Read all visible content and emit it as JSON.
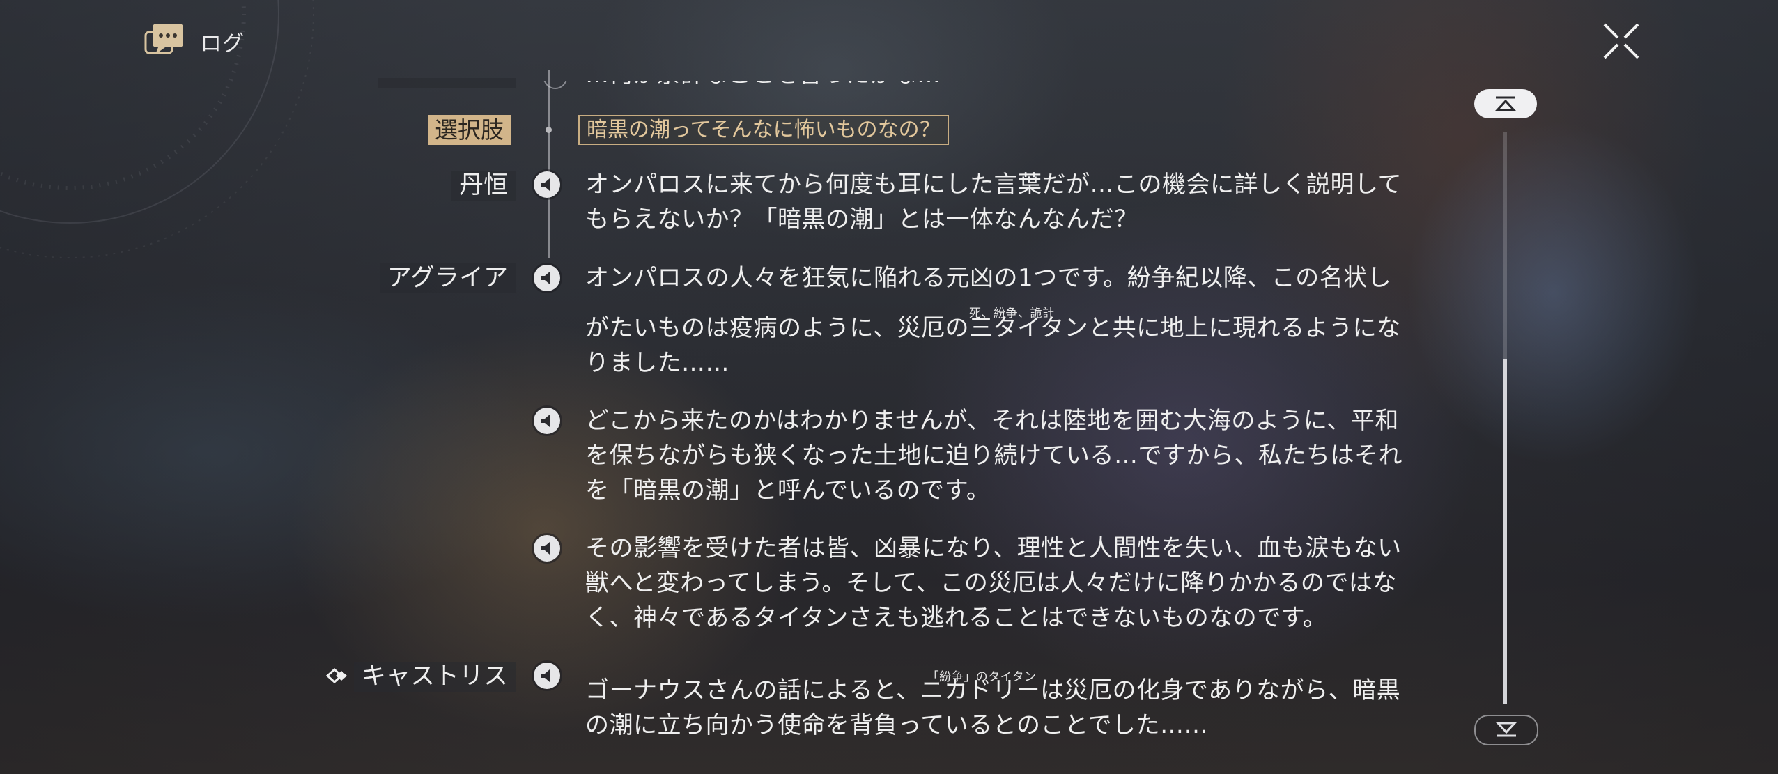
{
  "header": {
    "title": "ログ",
    "icon": "chat-bubble-icon"
  },
  "choice": {
    "tag": "選択肢",
    "text": "暗黒の潮ってそんなに怖いものなの？"
  },
  "entries": [
    {
      "speaker": "丹恒",
      "lines": [
        "オンパロスに来てから何度も耳にした言葉だが…この機会に詳しく説明して",
        "もらえないか？「暗黒の潮」とは一体なんなんだ？"
      ]
    },
    {
      "speaker": "アグライア",
      "line1": "オンパロスの人々を狂気に陥れる元凶の1つです。紛争紀以降、この名状し",
      "line2_pre": "がたいものは疫病のように、災厄の",
      "line2_ruby_base": "三タイタン",
      "line2_post": "と共に地上に現れるようにな",
      "ruby": "死、紛争、詭計",
      "line3": "りました……"
    },
    {
      "speaker": "",
      "lines": [
        "どこから来たのかはわかりませんが、それは陸地を囲む大海のように、平和",
        "を保ちながらも狭くなった土地に迫り続けている…ですから、私たちはそれ",
        "を「暗黒の潮」と呼んでいるのです。"
      ]
    },
    {
      "speaker": "",
      "lines": [
        "その影響を受けた者は皆、凶暴になり、理性と人間性を失い、血も涙もない",
        "獣へと変わってしまう。そして、この災厄は人々だけに降りかかるのではな",
        "く、神々であるタイタンさえも逃れることはできないものなのです。"
      ]
    },
    {
      "speaker": "キャストリス",
      "line1_pre": "ゴーナウスさんの話によると、",
      "line1_ruby_base": "ニカドリー",
      "line1_post": "は災厄の化身でありながら、暗黒",
      "ruby": "「紛争」のタイタン",
      "line2": "の潮に立ち向かう使命を背負っているとのことでした……"
    }
  ],
  "cut_text": "…何か余計なことを言ったかな…",
  "colors": {
    "accent": "#d2b58a",
    "choice_text": "#e2c79c",
    "text": "#efefef"
  }
}
